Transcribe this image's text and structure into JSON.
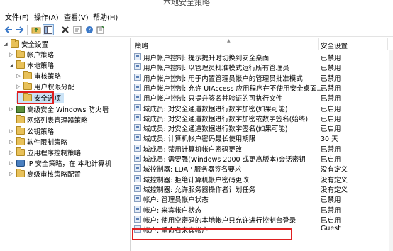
{
  "window": {
    "title": "本地安全策略"
  },
  "menu": [
    {
      "label": "文件(F)"
    },
    {
      "label": "操作(A)"
    },
    {
      "label": "查看(V)"
    },
    {
      "label": "帮助(H)"
    }
  ],
  "tree": [
    {
      "label": "安全设置",
      "expander": "◢",
      "icon": "folder"
    },
    {
      "label": "帐户策略",
      "expander": "▷",
      "icon": "folder"
    },
    {
      "label": "本地策略",
      "expander": "◢",
      "icon": "folder"
    },
    {
      "label": "审核策略",
      "expander": "▷",
      "icon": "folder"
    },
    {
      "label": "用户权限分配",
      "expander": "▷",
      "icon": "folder"
    },
    {
      "label": "安全选项",
      "expander": "",
      "icon": "folder"
    },
    {
      "label": "高级安全 Windows 防火墙",
      "expander": "▷",
      "icon": "firewall"
    },
    {
      "label": "网络列表管理器策略",
      "expander": "",
      "icon": "folder"
    },
    {
      "label": "公钥策略",
      "expander": "▷",
      "icon": "folder"
    },
    {
      "label": "软件限制策略",
      "expander": "▷",
      "icon": "folder"
    },
    {
      "label": "应用程序控制策略",
      "expander": "▷",
      "icon": "folder"
    },
    {
      "label": "IP 安全策略，在 本地计算机",
      "expander": "▷",
      "icon": "ipsec"
    },
    {
      "label": "高级审核策略配置",
      "expander": "▷",
      "icon": "folder"
    }
  ],
  "columns": {
    "policy": "策略",
    "setting": "安全设置"
  },
  "policies": [
    {
      "name": "用户帐户控制: 提示提升时切换到安全桌面",
      "value": "已禁用"
    },
    {
      "name": "用户帐户控制: 以管理员批准模式运行所有管理员",
      "value": "已禁用"
    },
    {
      "name": "用户帐户控制: 用于内置管理员帐户的管理员批准模式",
      "value": "已禁用"
    },
    {
      "name": "用户帐户控制: 允许 UIAccess 应用程序在不使用安全桌面...",
      "value": "已禁用"
    },
    {
      "name": "用户帐户控制: 只提升签名并验证的可执行文件",
      "value": "已禁用"
    },
    {
      "name": "域成员: 对安全通道数据进行数字加密(如果可能)",
      "value": "已启用"
    },
    {
      "name": "域成员: 对安全通道数据进行数字加密或数字签名(始终)",
      "value": "已启用"
    },
    {
      "name": "域成员: 对安全通道数据进行数字签名(如果可能)",
      "value": "已启用"
    },
    {
      "name": "域成员: 计算机帐户密码最长使用期限",
      "value": "30 天"
    },
    {
      "name": "域成员: 禁用计算机帐户密码更改",
      "value": "已禁用"
    },
    {
      "name": "域成员: 需要强(Windows 2000 或更高版本)会话密钥",
      "value": "已启用"
    },
    {
      "name": "域控制器: LDAP 服务器签名要求",
      "value": "没有定义"
    },
    {
      "name": "域控制器: 拒绝计算机帐户密码更改",
      "value": "没有定义"
    },
    {
      "name": "域控制器: 允许服务器操作者计划任务",
      "value": "没有定义"
    },
    {
      "name": "帐户: 管理员帐户状态",
      "value": "已禁用"
    },
    {
      "name": "帐户: 来宾帐户状态",
      "value": "已禁用"
    },
    {
      "name": "帐户: 使用空密码的本地帐户只允许进行控制台登录",
      "value": "已启用"
    },
    {
      "name": "帐户: 重命名来宾帐户",
      "value": "Guest"
    }
  ]
}
